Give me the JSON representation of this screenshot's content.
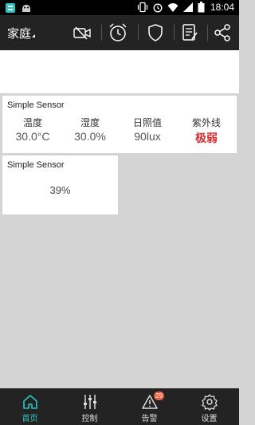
{
  "status_bar": {
    "time": "18:04",
    "left_icons": [
      "app-icon",
      "android-icon"
    ],
    "right_icons": [
      "vibrate-icon",
      "alarm-icon",
      "wifi-icon",
      "signal-icon",
      "battery-icon"
    ]
  },
  "toolbar": {
    "title": "家庭",
    "actions": [
      "video-off-icon",
      "alarm-clock-icon",
      "shield-icon",
      "log-icon",
      "share-icon"
    ]
  },
  "cards": [
    {
      "name": "Simple Sensor",
      "metrics": [
        {
          "label": "温度",
          "value": "30.0°C"
        },
        {
          "label": "湿度",
          "value": "30.0%"
        },
        {
          "label": "日照值",
          "value": "90lux"
        },
        {
          "label": "紫外线",
          "value": "极弱"
        }
      ]
    },
    {
      "name": "Simple Sensor",
      "value": "39%"
    }
  ],
  "bottom_nav": {
    "items": [
      {
        "label": "首页",
        "icon": "home-icon",
        "active": true
      },
      {
        "label": "控制",
        "icon": "sliders-icon",
        "active": false
      },
      {
        "label": "告警",
        "icon": "warning-icon",
        "active": false,
        "badge": "29"
      },
      {
        "label": "设置",
        "icon": "gear-icon",
        "active": false
      }
    ]
  },
  "colors": {
    "accent": "#2bc4c2",
    "alert_text": "#d32f2f",
    "bar_background": "#232323",
    "page_background": "#d4d4d4",
    "badge": "#e85a3a"
  }
}
